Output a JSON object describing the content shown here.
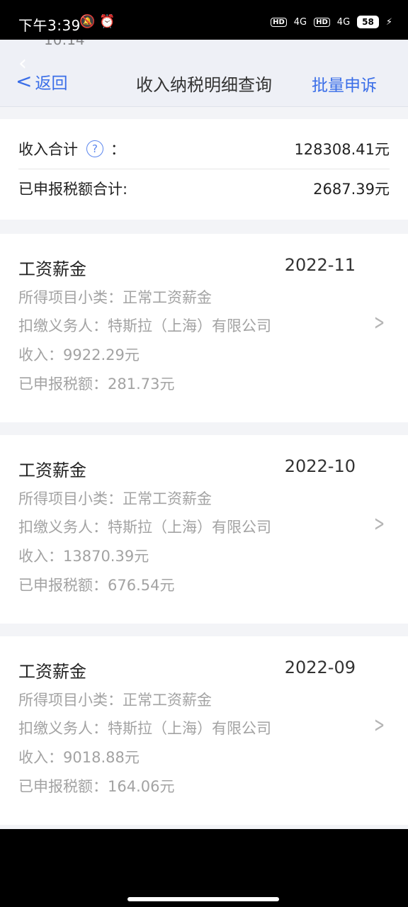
{
  "status_bar": {
    "time": "下午3:39",
    "icons_left": "🔕 ⏰",
    "hd1": "HD",
    "net1": "4G",
    "hd2": "HD",
    "net2": "4G",
    "battery": "58",
    "charging": "⚡"
  },
  "nav": {
    "back_label": "返回",
    "title": "收入纳税明细查询",
    "batch_label": "批量申诉",
    "ghost_time": "10:14"
  },
  "summary": {
    "income_label": "收入合计",
    "income_colon": "：",
    "income_value": "128308.41元",
    "tax_label": "已申报税额合计:",
    "tax_value": "2687.39元"
  },
  "records": [
    {
      "type": "工资薪金",
      "period": "2022-11",
      "subcategory": "所得项目小类：正常工资薪金",
      "withholder": "扣缴义务人：特斯拉（上海）有限公司",
      "income": "收入：9922.29元",
      "tax": "已申报税额：281.73元"
    },
    {
      "type": "工资薪金",
      "period": "2022-10",
      "subcategory": "所得项目小类：正常工资薪金",
      "withholder": "扣缴义务人：特斯拉（上海）有限公司",
      "income": "收入：13870.39元",
      "tax": "已申报税额：676.54元"
    },
    {
      "type": "工资薪金",
      "period": "2022-09",
      "subcategory": "所得项目小类：正常工资薪金",
      "withholder": "扣缴义务人：特斯拉（上海）有限公司",
      "income": "收入：9018.88元",
      "tax": "已申报税额：164.06元"
    }
  ],
  "icons": {
    "back": "chevron-left-icon",
    "help": "question-circle-icon",
    "row_arrow": "chevron-right-icon"
  },
  "colors": {
    "accent": "#3a6ee8",
    "background": "#f3f4f7",
    "muted_text": "#a3a3a3"
  }
}
